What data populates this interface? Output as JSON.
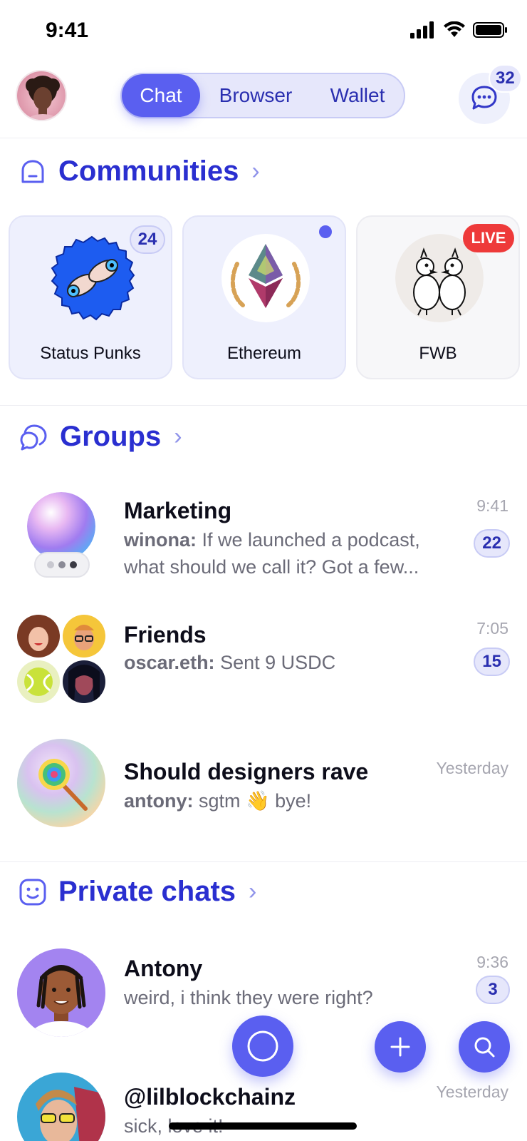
{
  "status_bar": {
    "time": "9:41"
  },
  "header": {
    "tabs": [
      {
        "label": "Chat",
        "active": true
      },
      {
        "label": "Browser",
        "active": false
      },
      {
        "label": "Wallet",
        "active": false
      }
    ],
    "chat_badge": "32"
  },
  "communities": {
    "title": "Communities",
    "items": [
      {
        "name": "Status Punks",
        "badge": "24"
      },
      {
        "name": "Ethereum",
        "badge": ""
      },
      {
        "name": "FWB",
        "badge": "LIVE"
      }
    ]
  },
  "groups": {
    "title": "Groups",
    "items": [
      {
        "title": "Marketing",
        "sender": "winona:",
        "message": "If we launched a podcast, what should we call it? Got a few...",
        "time": "9:41",
        "count": "22"
      },
      {
        "title": "Friends",
        "sender": "oscar.eth:",
        "message": "Sent 9 USDC",
        "time": "7:05",
        "count": "15"
      },
      {
        "title": "Should designers rave",
        "sender": "antony:",
        "message": "sgtm 👋 bye!",
        "time": "Yesterday",
        "count": ""
      }
    ]
  },
  "private_chats": {
    "title": "Private chats",
    "items": [
      {
        "title": "Antony",
        "message": "weird, i think they were right?",
        "time": "9:36",
        "count": "3"
      },
      {
        "title": "@lilblockchainz",
        "message": "sick, love it!",
        "time": "Yesterday",
        "count": ""
      }
    ]
  },
  "colors": {
    "accent": "#5a5ff0",
    "title_blue": "#2a2fd0",
    "live_red": "#ee3a3a"
  },
  "icons": [
    "signal-icon",
    "wifi-icon",
    "battery-icon",
    "chat-bubbles-icon",
    "community-icon",
    "groups-icon",
    "smiley-icon",
    "circle-icon",
    "plus-icon",
    "search-icon"
  ]
}
